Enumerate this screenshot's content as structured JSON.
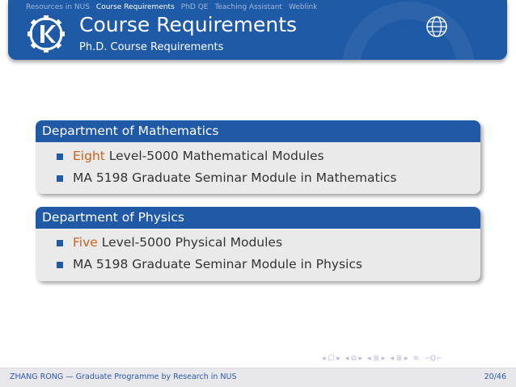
{
  "navbar": {
    "items": [
      {
        "label": "Resources in NUS",
        "active": false
      },
      {
        "label": "Course Requirements",
        "active": true
      },
      {
        "label": "PhD QE",
        "active": false
      },
      {
        "label": "Teaching Assistant",
        "active": false
      },
      {
        "label": "Weblink",
        "active": false
      }
    ]
  },
  "header": {
    "title": "Course Requirements",
    "subtitle": "Ph.D. Course Requirements"
  },
  "blocks": [
    {
      "title": "Department of Mathematics",
      "items": [
        {
          "accent": "Eight",
          "text": " Level-5000 Mathematical Modules"
        },
        {
          "accent": "",
          "text": "MA 5198 Graduate Seminar Module in Mathematics"
        }
      ]
    },
    {
      "title": "Department of Physics",
      "items": [
        {
          "accent": "Five",
          "text": " Level-5000 Physical Modules"
        },
        {
          "accent": "",
          "text": "MA 5198 Graduate Seminar Module in Physics"
        }
      ]
    }
  ],
  "footer": {
    "text": "ZHANG RONG — Graduate Programme by Research in NUS",
    "page": "20/46"
  },
  "colors": {
    "theme_blue": "#1f5aa6",
    "accent_orange": "#c9611f",
    "body_text": "#333333",
    "block_body_bg": "#eaeaea",
    "footer_bg": "#e8e8ec"
  },
  "icons": {
    "logo": "kde-logo-icon",
    "globe": "globe-icon",
    "bullet": "square-bullet-icon"
  }
}
